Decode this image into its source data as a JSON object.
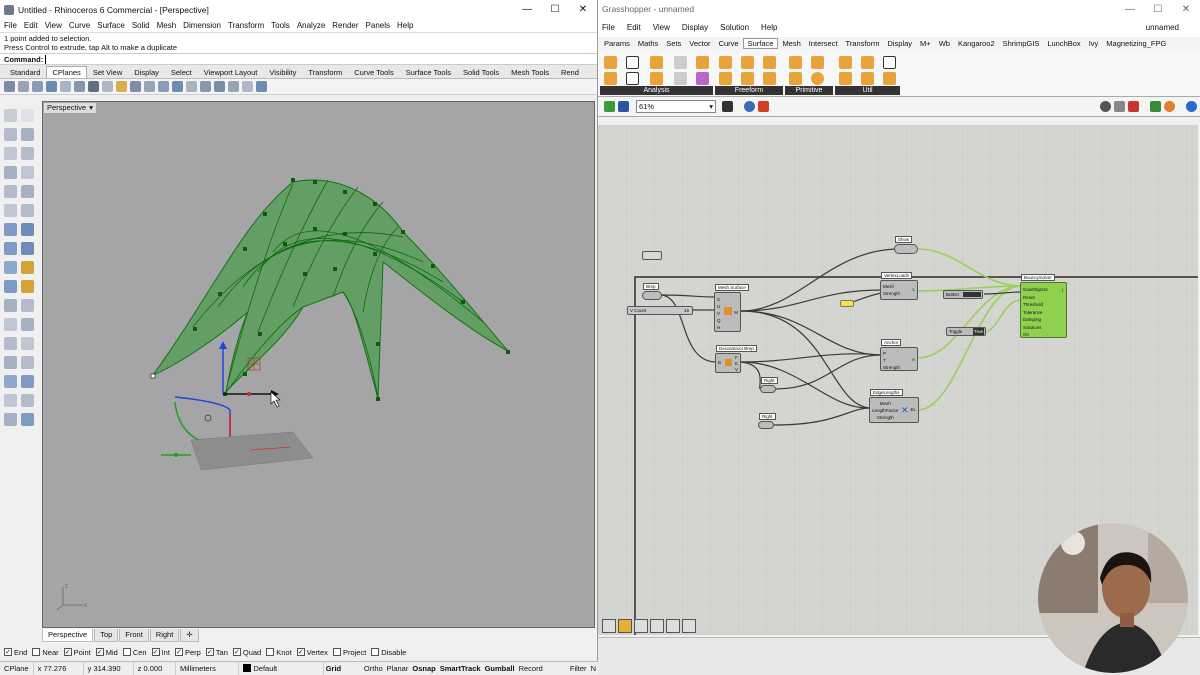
{
  "rhino": {
    "title": "Untitled - Rhinoceros 6 Commercial - [Perspective]",
    "menu": [
      "File",
      "Edit",
      "View",
      "Curve",
      "Surface",
      "Solid",
      "Mesh",
      "Dimension",
      "Transform",
      "Tools",
      "Analyze",
      "Render",
      "Panels",
      "Help"
    ],
    "history": [
      "1 point added to selection.",
      "Press Control to extrude, tap Alt to make a duplicate"
    ],
    "command_label": "Command:",
    "tabs": [
      "Standard",
      "CPlanes",
      "Set View",
      "Display",
      "Select",
      "Viewport Layout",
      "Visibility",
      "Transform",
      "Curve Tools",
      "Surface Tools",
      "Solid Tools",
      "Mesh Tools",
      "Rend"
    ],
    "active_tab": "CPlanes",
    "viewport_title": "Perspective",
    "viewport_tabs": [
      "Perspective",
      "Top",
      "Front",
      "Right"
    ],
    "osnaps": [
      {
        "label": "End",
        "checked": true
      },
      {
        "label": "Near",
        "checked": false
      },
      {
        "label": "Point",
        "checked": true
      },
      {
        "label": "Mid",
        "checked": true
      },
      {
        "label": "Cen",
        "checked": false
      },
      {
        "label": "Int",
        "checked": true
      },
      {
        "label": "Perp",
        "checked": true
      },
      {
        "label": "Tan",
        "checked": true
      },
      {
        "label": "Quad",
        "checked": true
      },
      {
        "label": "Knot",
        "checked": false
      },
      {
        "label": "Vertex",
        "checked": true
      },
      {
        "label": "Project",
        "checked": false
      },
      {
        "label": "Disable",
        "checked": false
      }
    ],
    "status": {
      "cplane": "CPlane",
      "x": "x 77.276",
      "y": "y 314.390",
      "z": "z 0.000",
      "units": "Millimeters",
      "layer": "Default",
      "toggles": [
        "Grid Snap",
        "Ortho",
        "Planar",
        "Osnap",
        "SmartTrack",
        "Gumball",
        "Record History",
        "Filter",
        "N"
      ]
    },
    "colors": {
      "mesh": "#1f8a1f",
      "viewport_bg": "#a5a5a8"
    }
  },
  "gh": {
    "title": "Grasshopper - unnamed",
    "doc_name": "unnamed",
    "menu": [
      "File",
      "Edit",
      "View",
      "Display",
      "Solution",
      "Help"
    ],
    "tabs": [
      "Params",
      "Maths",
      "Sets",
      "Vector",
      "Curve",
      "Surface",
      "Mesh",
      "Intersect",
      "Transform",
      "Display",
      "M+",
      "Wb",
      "Kangaroo2",
      "ShrimpGIS",
      "LunchBox",
      "Ivy",
      "Magnetizing_FPG"
    ],
    "active_tab": "Surface",
    "ribbon_groups": [
      "Analysis",
      "Freeform",
      "Primitive",
      "Util"
    ],
    "zoom": "61%",
    "components": {
      "mesh_surface": {
        "title": "Mesh Surface",
        "inputs": [
          "S",
          "U",
          "V",
          "Q",
          "H"
        ],
        "output": "M"
      },
      "vertex_loads": {
        "title": "VertexLoads",
        "inputs": [
          "Mesh",
          "Strength"
        ],
        "output": "L"
      },
      "anchor": {
        "title": "Anchor",
        "inputs": [
          "P",
          "T",
          "Strength"
        ],
        "output": "A"
      },
      "edge_lengths": {
        "title": "EdgeLengths",
        "inputs": [
          "Mesh",
          "LengthFactor",
          "Strength"
        ],
        "output": "EL"
      },
      "bouncy_solver": {
        "title": "BouncySolver",
        "inputs": [
          "GoalObjects",
          "Reset",
          "Threshold",
          "Tolerance",
          "Damping",
          "Solutions",
          "On"
        ],
        "output": "I"
      },
      "deconstruct_brep": {
        "title": "Deconstruct Brep",
        "inputs": [
          "B"
        ],
        "outputs": [
          "F",
          "E",
          "V"
        ]
      },
      "show": {
        "title": "Show"
      },
      "brep": {
        "title": "Brep"
      },
      "right_a": {
        "title": "Right"
      },
      "right_b": {
        "title": "Right"
      },
      "button": "Button",
      "toggle": "Toggle",
      "toggle_value": "True",
      "slider": {
        "label": "V Count",
        "value": "16"
      }
    },
    "colors": {
      "solver": "#8fd14f",
      "canvas": "#d4d4d0",
      "wire": "#3a3a3a",
      "green_wire": "#9ad05a"
    }
  }
}
